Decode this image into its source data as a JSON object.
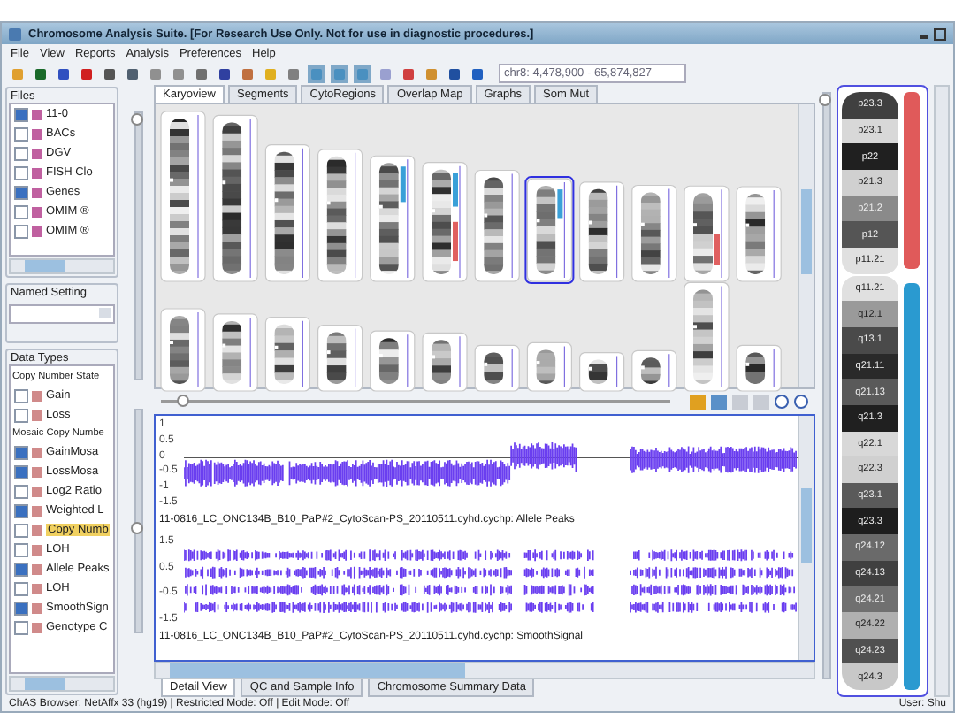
{
  "window": {
    "title": "Chromosome Analysis Suite. [For Research Use Only. Not for use in diagnostic procedures.]"
  },
  "menu": [
    "File",
    "View",
    "Reports",
    "Analysis",
    "Preferences",
    "Help"
  ],
  "toolbar": {
    "location": "chr8: 4,478,900 - 65,874,827"
  },
  "files": {
    "title": "Files",
    "items": [
      {
        "label": "11-0",
        "checked": true
      },
      {
        "label": "BACs",
        "checked": false
      },
      {
        "label": "DGV",
        "checked": false
      },
      {
        "label": "FISH Clo",
        "checked": false
      },
      {
        "label": "Genes",
        "checked": true
      },
      {
        "label": "OMIM ®",
        "checked": false
      },
      {
        "label": "OMIM ®",
        "checked": false
      }
    ]
  },
  "named_setting": {
    "title": "Named Setting"
  },
  "data_types": {
    "title": "Data Types",
    "items": [
      {
        "kind": "header",
        "label": "Copy Number State"
      },
      {
        "kind": "check",
        "label": "Gain",
        "checked": false,
        "selected": false
      },
      {
        "kind": "check",
        "label": "Loss",
        "checked": false,
        "selected": false
      },
      {
        "kind": "header",
        "label": "Mosaic Copy Numbe"
      },
      {
        "kind": "check",
        "label": "GainMosa",
        "checked": true,
        "selected": false
      },
      {
        "kind": "check",
        "label": "LossMosa",
        "checked": true,
        "selected": false
      },
      {
        "kind": "check",
        "label": "Log2 Ratio",
        "checked": false,
        "selected": false
      },
      {
        "kind": "check",
        "label": "Weighted L",
        "checked": true,
        "selected": false
      },
      {
        "kind": "check",
        "label": "Copy Numb",
        "checked": false,
        "selected": true
      },
      {
        "kind": "check",
        "label": "LOH",
        "checked": false,
        "selected": false
      },
      {
        "kind": "check",
        "label": "Allele Peaks",
        "checked": true,
        "selected": false
      },
      {
        "kind": "check",
        "label": "LOH",
        "checked": false,
        "selected": false
      },
      {
        "kind": "check",
        "label": "SmoothSign",
        "checked": true,
        "selected": false
      },
      {
        "kind": "check",
        "label": "Genotype C",
        "checked": false,
        "selected": false
      }
    ]
  },
  "karyo_slider": {
    "level": 1
  },
  "tabs": [
    {
      "label": "Karyoview",
      "selected": true
    },
    {
      "label": "Segments",
      "selected": false
    },
    {
      "label": "CytoRegions",
      "selected": false
    },
    {
      "label": "Overlap Map",
      "selected": false
    },
    {
      "label": "Graphs",
      "selected": false
    },
    {
      "label": "Som Mut",
      "selected": false
    }
  ],
  "zoom_slider": {
    "level": 0.03
  },
  "detail_slider": {
    "level": 0.5
  },
  "detail": {
    "tracks": [
      {
        "ticks": [
          "1",
          "0.5",
          "0",
          "-0.5",
          "-1",
          "-1.5"
        ],
        "label": "11-0816_LC_ONC134B_B10_PaP#2_CytoScan-PS_20110511.cyhd.cychp: Allele Peaks"
      },
      {
        "ticks": [
          "1.5",
          "0.5",
          "-0.5",
          "-1.5"
        ],
        "label": "11-0816_LC_ONC134B_B10_PaP#2_CytoScan-PS_20110511.cyhd.cychp: SmoothSignal"
      }
    ]
  },
  "bottom_tabs": [
    {
      "label": "Detail View",
      "selected": true
    },
    {
      "label": "QC and Sample Info",
      "selected": false
    },
    {
      "label": "Chromosome Summary Data",
      "selected": false
    }
  ],
  "ideogram_slider": {
    "level": 1
  },
  "chromosome": {
    "p_arm": [
      {
        "label": "p23.3",
        "color": "#404040"
      },
      {
        "label": "p23.1",
        "color": "#d8d8d8"
      },
      {
        "label": "p22",
        "color": "#202020"
      },
      {
        "label": "p21.3",
        "color": "#d0d0d0"
      },
      {
        "label": "p21.2",
        "color": "#8a8a8a"
      },
      {
        "label": "p12",
        "color": "#555555"
      },
      {
        "label": "p11.21",
        "color": "#e0e0e0"
      }
    ],
    "q_arm": [
      {
        "label": "q11.21",
        "color": "#e0e0e0"
      },
      {
        "label": "q12.1",
        "color": "#9a9a9a"
      },
      {
        "label": "q13.1",
        "color": "#4a4a4a"
      },
      {
        "label": "q21.11",
        "color": "#2a2a2a"
      },
      {
        "label": "q21.13",
        "color": "#5a5a5a"
      },
      {
        "label": "q21.3",
        "color": "#202020"
      },
      {
        "label": "q22.1",
        "color": "#d8d8d8"
      },
      {
        "label": "q22.3",
        "color": "#d0d0d0"
      },
      {
        "label": "q23.1",
        "color": "#5a5a5a"
      },
      {
        "label": "q23.3",
        "color": "#1e1e1e"
      },
      {
        "label": "q24.12",
        "color": "#6a6a6a"
      },
      {
        "label": "q24.13",
        "color": "#404040"
      },
      {
        "label": "q24.21",
        "color": "#707070"
      },
      {
        "label": "q24.22",
        "color": "#b0b0b0"
      },
      {
        "label": "q24.23",
        "color": "#505050"
      },
      {
        "label": "q24.3",
        "color": "#c8c8c8"
      }
    ]
  },
  "status_bar": {
    "text": "ChAS Browser: NetAffx 33 (hg19) | Restricted Mode: Off | Edit Mode: Off",
    "user": "User: Shu"
  }
}
